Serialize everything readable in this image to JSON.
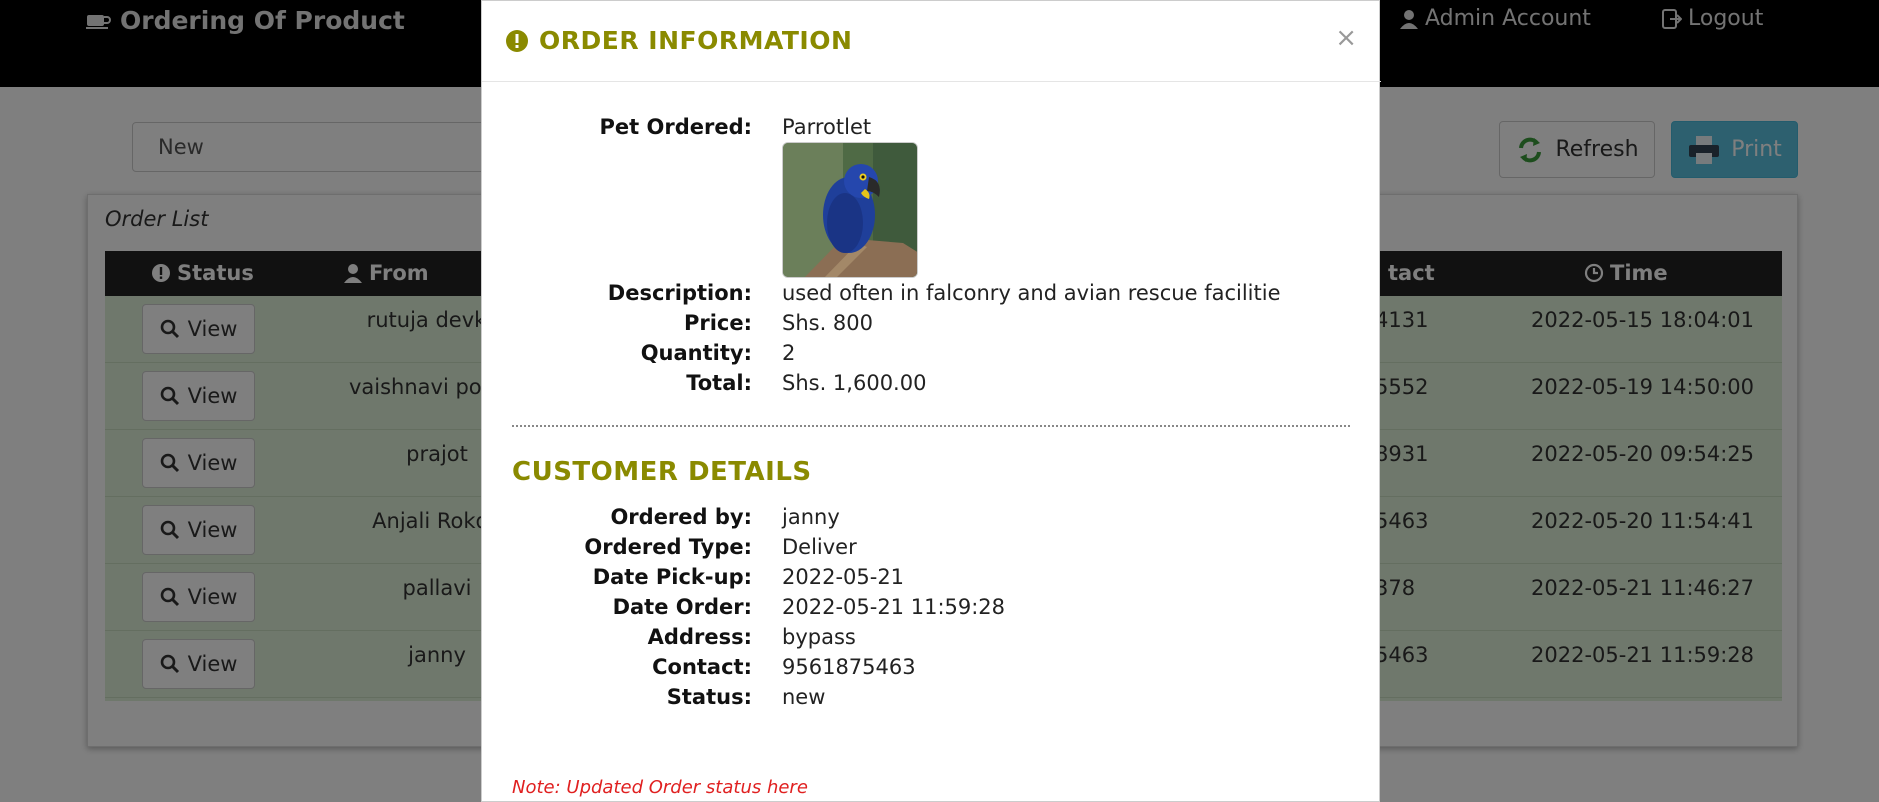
{
  "navbar": {
    "brand": "Ordering Of Product",
    "admin_account": "Admin Account",
    "logout": "Logout"
  },
  "filter": {
    "value": "New"
  },
  "toolbar": {
    "refresh_label": "Refresh",
    "print_label": "Print"
  },
  "panel": {
    "title": "Order List"
  },
  "table": {
    "headers": {
      "status": "Status",
      "from": "From",
      "contact": "tact",
      "time": "Time"
    },
    "view_label": "View",
    "rows": [
      {
        "from": "rutuja devkar",
        "contact": "4131",
        "time": "2022-05-15 18:04:01"
      },
      {
        "from": "vaishnavi pokale",
        "contact": "5552",
        "time": "2022-05-19 14:50:00"
      },
      {
        "from": "prajot",
        "contact": "8931",
        "time": "2022-05-20 09:54:25"
      },
      {
        "from": "Anjali Rokde",
        "contact": "5463",
        "time": "2022-05-20 11:54:41"
      },
      {
        "from": "pallavi",
        "contact": "378",
        "time": "2022-05-21 11:46:27"
      },
      {
        "from": "janny",
        "contact": "5463",
        "time": "2022-05-21 11:59:28"
      }
    ]
  },
  "modal": {
    "title": "ORDER INFORMATION",
    "close": "×",
    "order": {
      "pet_label": "Pet Ordered:",
      "pet_value": "Parrotlet",
      "description_label": "Description:",
      "description_value": "used often in falconry and avian rescue facilitie",
      "price_label": "Price:",
      "price_value": "Shs. 800",
      "quantity_label": "Quantity:",
      "quantity_value": "2",
      "total_label": "Total:",
      "total_value": "Shs. 1,600.00"
    },
    "customer": {
      "section_title": "CUSTOMER DETAILS",
      "ordered_by_label": "Ordered by:",
      "ordered_by_value": "janny",
      "ordered_type_label": "Ordered Type:",
      "ordered_type_value": "Deliver",
      "pickup_label": "Date Pick-up:",
      "pickup_value": "2022-05-21",
      "date_order_label": "Date Order:",
      "date_order_value": "2022-05-21 11:59:28",
      "address_label": "Address:",
      "address_value": "bypass",
      "contact_label": "Contact:",
      "contact_value": "9561875463",
      "status_label": "Status:",
      "status_value": "new"
    },
    "note": "Note: Updated Order status here"
  },
  "colors": {
    "accent_olive": "#8a8a00",
    "print_blue": "#5bc0de",
    "row_green": "#dff0d8",
    "note_red": "#e02020"
  }
}
